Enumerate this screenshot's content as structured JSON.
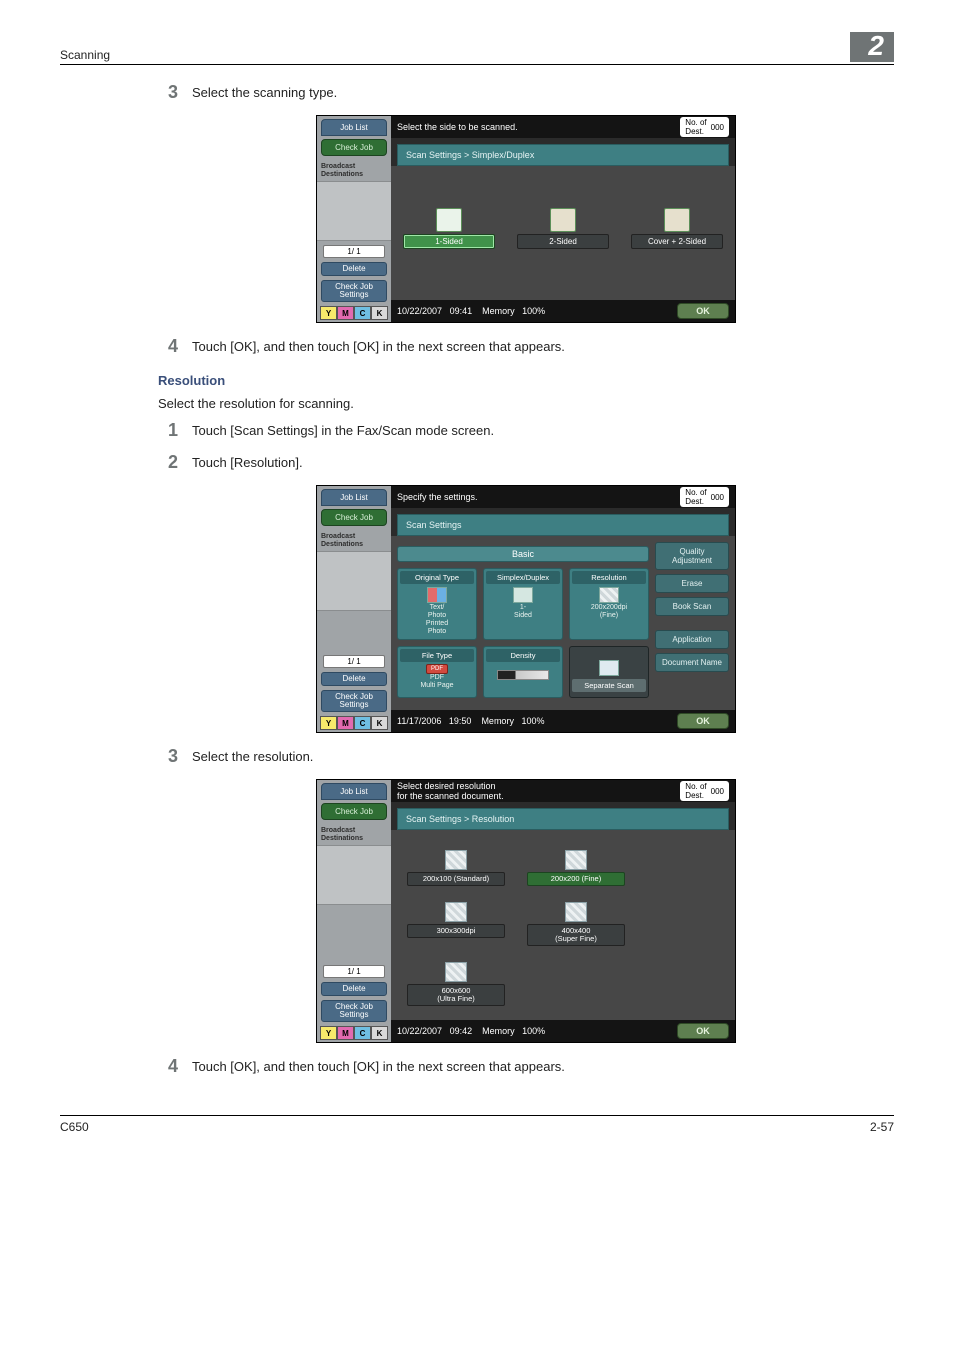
{
  "page": {
    "header_left": "Scanning",
    "header_right": "2",
    "footer_left": "C650",
    "footer_right": "2-57"
  },
  "steps": {
    "s3a": "Select the scanning type.",
    "s4a": "Touch [OK], and then touch [OK] in the next screen that appears.",
    "s1b": "Touch [Scan Settings] in the Fax/Scan mode screen.",
    "s2b": "Touch [Resolution].",
    "s3b": "Select the resolution.",
    "s4b": "Touch [OK], and then touch [OK] in the next screen that appears."
  },
  "section": {
    "resolution_heading": "Resolution",
    "resolution_intro": "Select the resolution for scanning."
  },
  "left": {
    "job_list": "Job List",
    "check_job": "Check Job",
    "broadcast": "Broadcast\nDestinations",
    "pager": "1/  1",
    "delete": "Delete",
    "check_job_settings": "Check Job\nSettings",
    "toner": {
      "y": "Y",
      "m": "M",
      "c": "C",
      "k": "K"
    }
  },
  "common": {
    "dest_label": "No. of\nDest.",
    "dest_count": "000",
    "ok": "OK",
    "memory": "Memory",
    "mem_pct": "100%"
  },
  "screen1": {
    "title": "Select the side to be scanned.",
    "breadcrumb": "Scan Settings > Simplex/Duplex",
    "opt1": "1-Sided",
    "opt2": "2-Sided",
    "opt3": "Cover + 2-Sided",
    "date": "10/22/2007",
    "time": "09:41"
  },
  "screen2": {
    "title": "Specify the settings.",
    "breadcrumb": "Scan Settings",
    "basic": "Basic",
    "tiles": {
      "original_type": "Original Type",
      "original_type_sub": "Text/\nPhoto\nPrinted\nPhoto",
      "simplex_duplex": "Simplex/Duplex",
      "simplex_duplex_sub": "1-\nSided",
      "resolution": "Resolution",
      "resolution_sub": "200x200dpi\n(Fine)",
      "file_type": "File Type",
      "file_type_badge": "PDF",
      "file_type_sub": "PDF\nMulti Page",
      "density": "Density",
      "separate_scan": "Separate Scan"
    },
    "side": {
      "quality": "Quality\nAdjustment",
      "erase": "Erase",
      "book_scan": "Book Scan",
      "application": "Application",
      "document_name": "Document Name"
    },
    "date": "11/17/2006",
    "time": "19:50"
  },
  "screen3": {
    "title": "Select desired resolution\nfor the scanned document.",
    "breadcrumb": "Scan Settings > Resolution",
    "opts": {
      "r1": "200x100 (Standard)",
      "r2": "200x200 (Fine)",
      "r3": "300x300dpi",
      "r4": "400x400\n(Super Fine)",
      "r5": "600x600\n(Ultra Fine)"
    },
    "date": "10/22/2007",
    "time": "09:42"
  }
}
